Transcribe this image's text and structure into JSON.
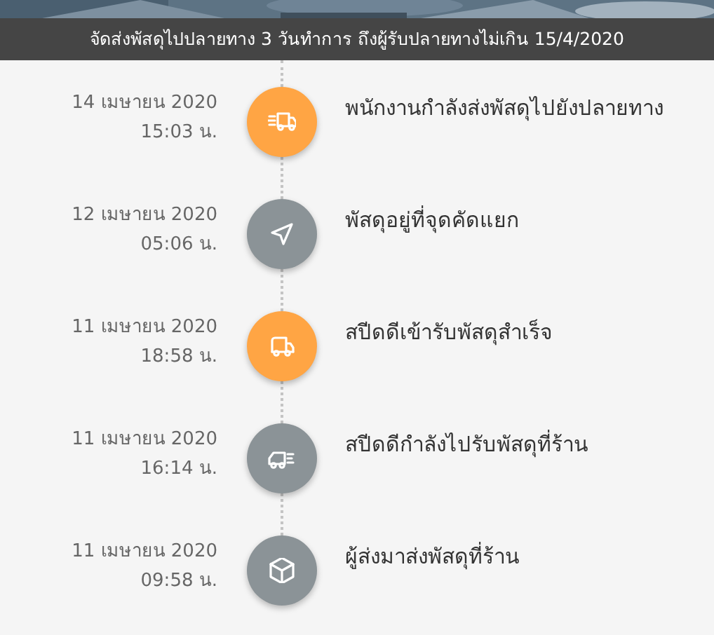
{
  "banner": {
    "text": "จัดส่งพัสดุไปปลายทาง 3 วันทำการ ถึงผู้รับปลายทางไม่เกิน 15/4/2020"
  },
  "timeline": [
    {
      "date": "14 เมษายน 2020",
      "time": "15:03 น.",
      "status": "พนักงานกำลังส่งพัสดุไปยังปลายทาง",
      "color": "#ffa544",
      "kind": "fast-truck"
    },
    {
      "date": "12 เมษายน 2020",
      "time": "05:06 น.",
      "status": "พัสดุอยู่ที่จุดคัดแยก",
      "color": "#8b9397",
      "kind": "navigation"
    },
    {
      "date": "11 เมษายน 2020",
      "time": "18:58 น.",
      "status": "สปีดดีเข้ารับพัสดุสำเร็จ",
      "color": "#ffa544",
      "kind": "truck"
    },
    {
      "date": "11 เมษายน 2020",
      "time": "16:14 น.",
      "status": "สปีดดีกำลังไปรับพัสดุที่ร้าน",
      "color": "#8b9397",
      "kind": "moving-truck"
    },
    {
      "date": "11 เมษายน 2020",
      "time": "09:58 น.",
      "status": "ผู้ส่งมาส่งพัสดุที่ร้าน",
      "color": "#8b9397",
      "kind": "box"
    }
  ]
}
